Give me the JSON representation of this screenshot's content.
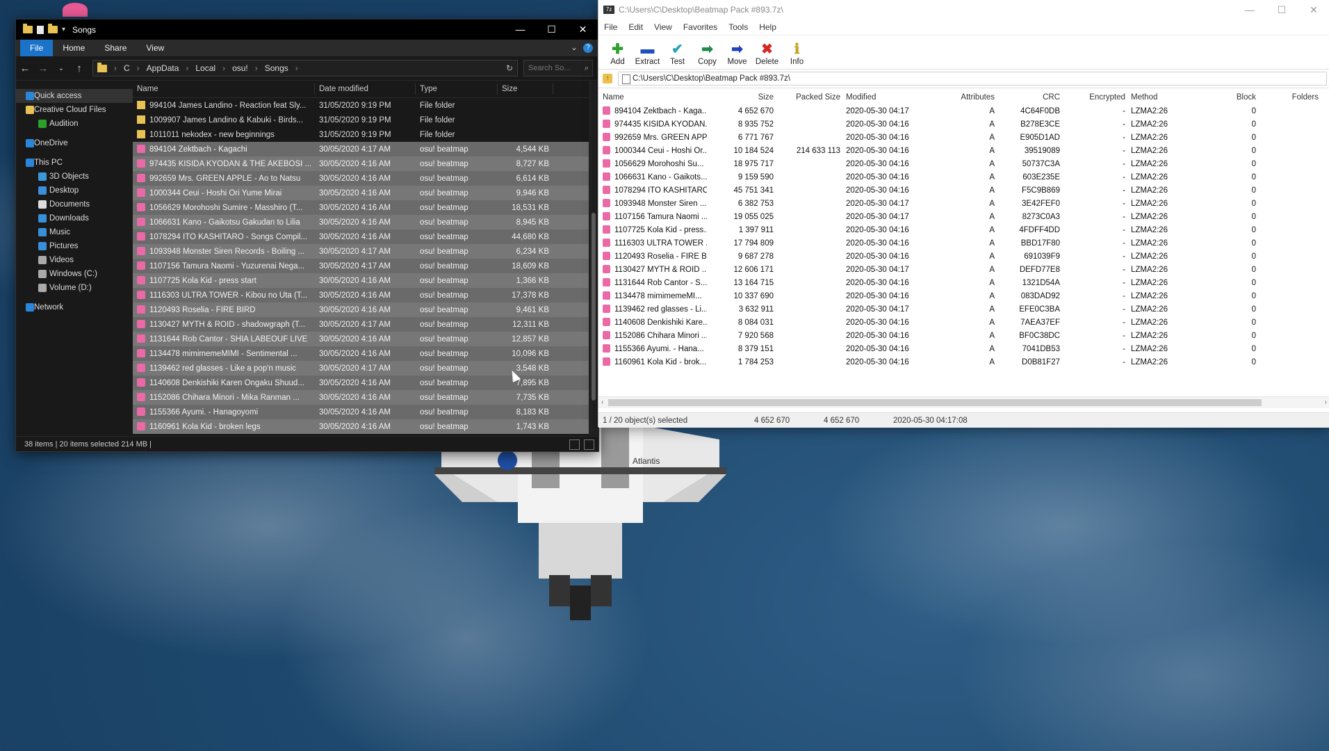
{
  "explorer": {
    "title": "Songs",
    "ribbon_tabs": [
      "File",
      "Home",
      "Share",
      "View"
    ],
    "breadcrumb": [
      "C",
      "AppData",
      "Local",
      "osu!",
      "Songs"
    ],
    "search_placeholder": "Search So...",
    "nav": [
      {
        "label": "Quick access",
        "indent": false,
        "selected": true
      },
      {
        "label": "Creative Cloud Files",
        "indent": false
      },
      {
        "label": "Audition",
        "indent": true
      },
      {
        "label": "OneDrive",
        "indent": false
      },
      {
        "label": "This PC",
        "indent": false
      },
      {
        "label": "3D Objects",
        "indent": true
      },
      {
        "label": "Desktop",
        "indent": true
      },
      {
        "label": "Documents",
        "indent": true
      },
      {
        "label": "Downloads",
        "indent": true
      },
      {
        "label": "Music",
        "indent": true
      },
      {
        "label": "Pictures",
        "indent": true
      },
      {
        "label": "Videos",
        "indent": true
      },
      {
        "label": "Windows (C:)",
        "indent": true
      },
      {
        "label": "Volume (D:)",
        "indent": true
      },
      {
        "label": "Network",
        "indent": false
      }
    ],
    "columns": {
      "name": "Name",
      "date": "Date modified",
      "type": "Type",
      "size": "Size"
    },
    "files": [
      {
        "name": "994104 James Landino - Reaction feat Sly...",
        "date": "31/05/2020 9:19 PM",
        "type": "File folder",
        "size": "",
        "kind": "folder",
        "sel": false
      },
      {
        "name": "1009907 James Landino & Kabuki - Birds...",
        "date": "31/05/2020 9:19 PM",
        "type": "File folder",
        "size": "",
        "kind": "folder",
        "sel": false
      },
      {
        "name": "1011011 nekodex - new beginnings",
        "date": "31/05/2020 9:19 PM",
        "type": "File folder",
        "size": "",
        "kind": "folder",
        "sel": false
      },
      {
        "name": "894104 Zektbach - Kagachi",
        "date": "30/05/2020 4:17 AM",
        "type": "osu! beatmap",
        "size": "4,544 KB",
        "kind": "osu",
        "sel": true
      },
      {
        "name": "974435 KISIDA KYODAN & THE AKEBOSI ...",
        "date": "30/05/2020 4:16 AM",
        "type": "osu! beatmap",
        "size": "8,727 KB",
        "kind": "osu",
        "sel": true
      },
      {
        "name": "992659 Mrs. GREEN APPLE - Ao to Natsu",
        "date": "30/05/2020 4:16 AM",
        "type": "osu! beatmap",
        "size": "6,614 KB",
        "kind": "osu",
        "sel": true
      },
      {
        "name": "1000344 Ceui - Hoshi Ori Yume Mirai",
        "date": "30/05/2020 4:16 AM",
        "type": "osu! beatmap",
        "size": "9,946 KB",
        "kind": "osu",
        "sel": true
      },
      {
        "name": "1056629 Morohoshi Sumire - Masshiro (T...",
        "date": "30/05/2020 4:16 AM",
        "type": "osu! beatmap",
        "size": "18,531 KB",
        "kind": "osu",
        "sel": true
      },
      {
        "name": "1066631 Kano - Gaikotsu Gakudan to Lilia",
        "date": "30/05/2020 4:16 AM",
        "type": "osu! beatmap",
        "size": "8,945 KB",
        "kind": "osu",
        "sel": true
      },
      {
        "name": "1078294 ITO KASHITARO - Songs Compil...",
        "date": "30/05/2020 4:16 AM",
        "type": "osu! beatmap",
        "size": "44,680 KB",
        "kind": "osu",
        "sel": true
      },
      {
        "name": "1093948 Monster Siren Records - Boiling ...",
        "date": "30/05/2020 4:17 AM",
        "type": "osu! beatmap",
        "size": "6,234 KB",
        "kind": "osu",
        "sel": true
      },
      {
        "name": "1107156 Tamura Naomi - Yuzurenai Nega...",
        "date": "30/05/2020 4:17 AM",
        "type": "osu! beatmap",
        "size": "18,609 KB",
        "kind": "osu",
        "sel": true
      },
      {
        "name": "1107725 Kola Kid - press start",
        "date": "30/05/2020 4:16 AM",
        "type": "osu! beatmap",
        "size": "1,366 KB",
        "kind": "osu",
        "sel": true
      },
      {
        "name": "1116303 ULTRA TOWER - Kibou no Uta (T...",
        "date": "30/05/2020 4:16 AM",
        "type": "osu! beatmap",
        "size": "17,378 KB",
        "kind": "osu",
        "sel": true
      },
      {
        "name": "1120493 Roselia - FIRE BIRD",
        "date": "30/05/2020 4:16 AM",
        "type": "osu! beatmap",
        "size": "9,461 KB",
        "kind": "osu",
        "sel": true
      },
      {
        "name": "1130427 MYTH & ROID - shadowgraph (T...",
        "date": "30/05/2020 4:17 AM",
        "type": "osu! beatmap",
        "size": "12,311 KB",
        "kind": "osu",
        "sel": true
      },
      {
        "name": "1131644 Rob Cantor - SHIA LABEOUF LIVE",
        "date": "30/05/2020 4:16 AM",
        "type": "osu! beatmap",
        "size": "12,857 KB",
        "kind": "osu",
        "sel": true
      },
      {
        "name": "1134478 mimimemeMIMI - Sentimental ...",
        "date": "30/05/2020 4:16 AM",
        "type": "osu! beatmap",
        "size": "10,096 KB",
        "kind": "osu",
        "sel": true
      },
      {
        "name": "1139462 red glasses - Like a pop'n music",
        "date": "30/05/2020 4:17 AM",
        "type": "osu! beatmap",
        "size": "3,548 KB",
        "kind": "osu",
        "sel": true
      },
      {
        "name": "1140608 Denkishiki Karen Ongaku Shuud...",
        "date": "30/05/2020 4:16 AM",
        "type": "osu! beatmap",
        "size": "7,895 KB",
        "kind": "osu",
        "sel": true
      },
      {
        "name": "1152086 Chihara Minori - Mika Ranman ...",
        "date": "30/05/2020 4:16 AM",
        "type": "osu! beatmap",
        "size": "7,735 KB",
        "kind": "osu",
        "sel": true
      },
      {
        "name": "1155366 Ayumi. - Hanagoyomi",
        "date": "30/05/2020 4:16 AM",
        "type": "osu! beatmap",
        "size": "8,183 KB",
        "kind": "osu",
        "sel": true
      },
      {
        "name": "1160961 Kola Kid - broken legs",
        "date": "30/05/2020 4:16 AM",
        "type": "osu! beatmap",
        "size": "1,743 KB",
        "kind": "osu",
        "sel": true
      }
    ],
    "status": "38 items  |  20 items selected  214 MB  |"
  },
  "zip": {
    "title": "C:\\Users\\C\\Desktop\\Beatmap Pack #893.7z\\",
    "menu": [
      "File",
      "Edit",
      "View",
      "Favorites",
      "Tools",
      "Help"
    ],
    "tools": [
      {
        "label": "Add",
        "icon": "add-icon",
        "glyph": "✚",
        "color": "#2ca02c"
      },
      {
        "label": "Extract",
        "icon": "extract-icon",
        "glyph": "▬",
        "color": "#1f4fbf"
      },
      {
        "label": "Test",
        "icon": "test-icon",
        "glyph": "✔",
        "color": "#27a3b8"
      },
      {
        "label": "Copy",
        "icon": "copy-icon",
        "glyph": "➡",
        "color": "#1f8a4a"
      },
      {
        "label": "Move",
        "icon": "move-icon",
        "glyph": "➡",
        "color": "#1f3fbf"
      },
      {
        "label": "Delete",
        "icon": "delete-icon",
        "glyph": "✖",
        "color": "#d62728"
      },
      {
        "label": "Info",
        "icon": "info-icon",
        "glyph": "ℹ",
        "color": "#c9a227"
      }
    ],
    "path": "C:\\Users\\C\\Desktop\\Beatmap Pack #893.7z\\",
    "columns": [
      "Name",
      "Size",
      "Packed Size",
      "Modified",
      "Attributes",
      "CRC",
      "Encrypted",
      "Method",
      "Block",
      "Folders"
    ],
    "rows": [
      {
        "name": "894104 Zektbach - Kaga...",
        "size": "4 652 670",
        "packed": "",
        "mod": "2020-05-30 04:17",
        "attr": "A",
        "crc": "4C64F0DB",
        "enc": "-",
        "meth": "LZMA2:26",
        "block": "0"
      },
      {
        "name": "974435 KISIDA KYODAN...",
        "size": "8 935 752",
        "packed": "",
        "mod": "2020-05-30 04:16",
        "attr": "A",
        "crc": "B278E3CE",
        "enc": "-",
        "meth": "LZMA2:26",
        "block": "0"
      },
      {
        "name": "992659 Mrs. GREEN APP...",
        "size": "6 771 767",
        "packed": "",
        "mod": "2020-05-30 04:16",
        "attr": "A",
        "crc": "E905D1AD",
        "enc": "-",
        "meth": "LZMA2:26",
        "block": "0"
      },
      {
        "name": "1000344 Ceui - Hoshi Or...",
        "size": "10 184 524",
        "packed": "214 633 113",
        "mod": "2020-05-30 04:16",
        "attr": "A",
        "crc": "39519089",
        "enc": "-",
        "meth": "LZMA2:26",
        "block": "0"
      },
      {
        "name": "1056629 Morohoshi Su...",
        "size": "18 975 717",
        "packed": "",
        "mod": "2020-05-30 04:16",
        "attr": "A",
        "crc": "50737C3A",
        "enc": "-",
        "meth": "LZMA2:26",
        "block": "0"
      },
      {
        "name": "1066631 Kano - Gaikots...",
        "size": "9 159 590",
        "packed": "",
        "mod": "2020-05-30 04:16",
        "attr": "A",
        "crc": "603E235E",
        "enc": "-",
        "meth": "LZMA2:26",
        "block": "0"
      },
      {
        "name": "1078294 ITO KASHITARO...",
        "size": "45 751 341",
        "packed": "",
        "mod": "2020-05-30 04:16",
        "attr": "A",
        "crc": "F5C9B869",
        "enc": "-",
        "meth": "LZMA2:26",
        "block": "0"
      },
      {
        "name": "1093948 Monster Siren ...",
        "size": "6 382 753",
        "packed": "",
        "mod": "2020-05-30 04:17",
        "attr": "A",
        "crc": "3E42FEF0",
        "enc": "-",
        "meth": "LZMA2:26",
        "block": "0"
      },
      {
        "name": "1107156 Tamura Naomi ...",
        "size": "19 055 025",
        "packed": "",
        "mod": "2020-05-30 04:17",
        "attr": "A",
        "crc": "8273C0A3",
        "enc": "-",
        "meth": "LZMA2:26",
        "block": "0"
      },
      {
        "name": "1107725 Kola Kid - press...",
        "size": "1 397 911",
        "packed": "",
        "mod": "2020-05-30 04:16",
        "attr": "A",
        "crc": "4FDFF4DD",
        "enc": "-",
        "meth": "LZMA2:26",
        "block": "0"
      },
      {
        "name": "1116303 ULTRA TOWER ...",
        "size": "17 794 809",
        "packed": "",
        "mod": "2020-05-30 04:16",
        "attr": "A",
        "crc": "BBD17F80",
        "enc": "-",
        "meth": "LZMA2:26",
        "block": "0"
      },
      {
        "name": "1120493 Roselia - FIRE B...",
        "size": "9 687 278",
        "packed": "",
        "mod": "2020-05-30 04:16",
        "attr": "A",
        "crc": "691039F9",
        "enc": "-",
        "meth": "LZMA2:26",
        "block": "0"
      },
      {
        "name": "1130427 MYTH & ROID ...",
        "size": "12 606 171",
        "packed": "",
        "mod": "2020-05-30 04:17",
        "attr": "A",
        "crc": "DEFD77E8",
        "enc": "-",
        "meth": "LZMA2:26",
        "block": "0"
      },
      {
        "name": "1131644 Rob Cantor - S...",
        "size": "13 164 715",
        "packed": "",
        "mod": "2020-05-30 04:16",
        "attr": "A",
        "crc": "1321D54A",
        "enc": "-",
        "meth": "LZMA2:26",
        "block": "0"
      },
      {
        "name": "1134478 mimimemeMI...",
        "size": "10 337 690",
        "packed": "",
        "mod": "2020-05-30 04:16",
        "attr": "A",
        "crc": "083DAD92",
        "enc": "-",
        "meth": "LZMA2:26",
        "block": "0"
      },
      {
        "name": "1139462 red glasses - Li...",
        "size": "3 632 911",
        "packed": "",
        "mod": "2020-05-30 04:17",
        "attr": "A",
        "crc": "EFE0C3BA",
        "enc": "-",
        "meth": "LZMA2:26",
        "block": "0"
      },
      {
        "name": "1140608 Denkishiki Kare...",
        "size": "8 084 031",
        "packed": "",
        "mod": "2020-05-30 04:16",
        "attr": "A",
        "crc": "7AEA37EF",
        "enc": "-",
        "meth": "LZMA2:26",
        "block": "0"
      },
      {
        "name": "1152086 Chihara Minori ...",
        "size": "7 920 568",
        "packed": "",
        "mod": "2020-05-30 04:16",
        "attr": "A",
        "crc": "BF0C38DC",
        "enc": "-",
        "meth": "LZMA2:26",
        "block": "0"
      },
      {
        "name": "1155366 Ayumi. - Hana...",
        "size": "8 379 151",
        "packed": "",
        "mod": "2020-05-30 04:16",
        "attr": "A",
        "crc": "7041DB53",
        "enc": "-",
        "meth": "LZMA2:26",
        "block": "0"
      },
      {
        "name": "1160961 Kola Kid - brok...",
        "size": "1 784 253",
        "packed": "",
        "mod": "2020-05-30 04:16",
        "attr": "A",
        "crc": "D0B81F27",
        "enc": "-",
        "meth": "LZMA2:26",
        "block": "0"
      }
    ],
    "status": {
      "selected": "1 / 20 object(s) selected",
      "size": "4 652 670",
      "packed": "4 652 670",
      "modified": "2020-05-30 04:17:08"
    }
  },
  "wallpaper_text": "Atlantis"
}
